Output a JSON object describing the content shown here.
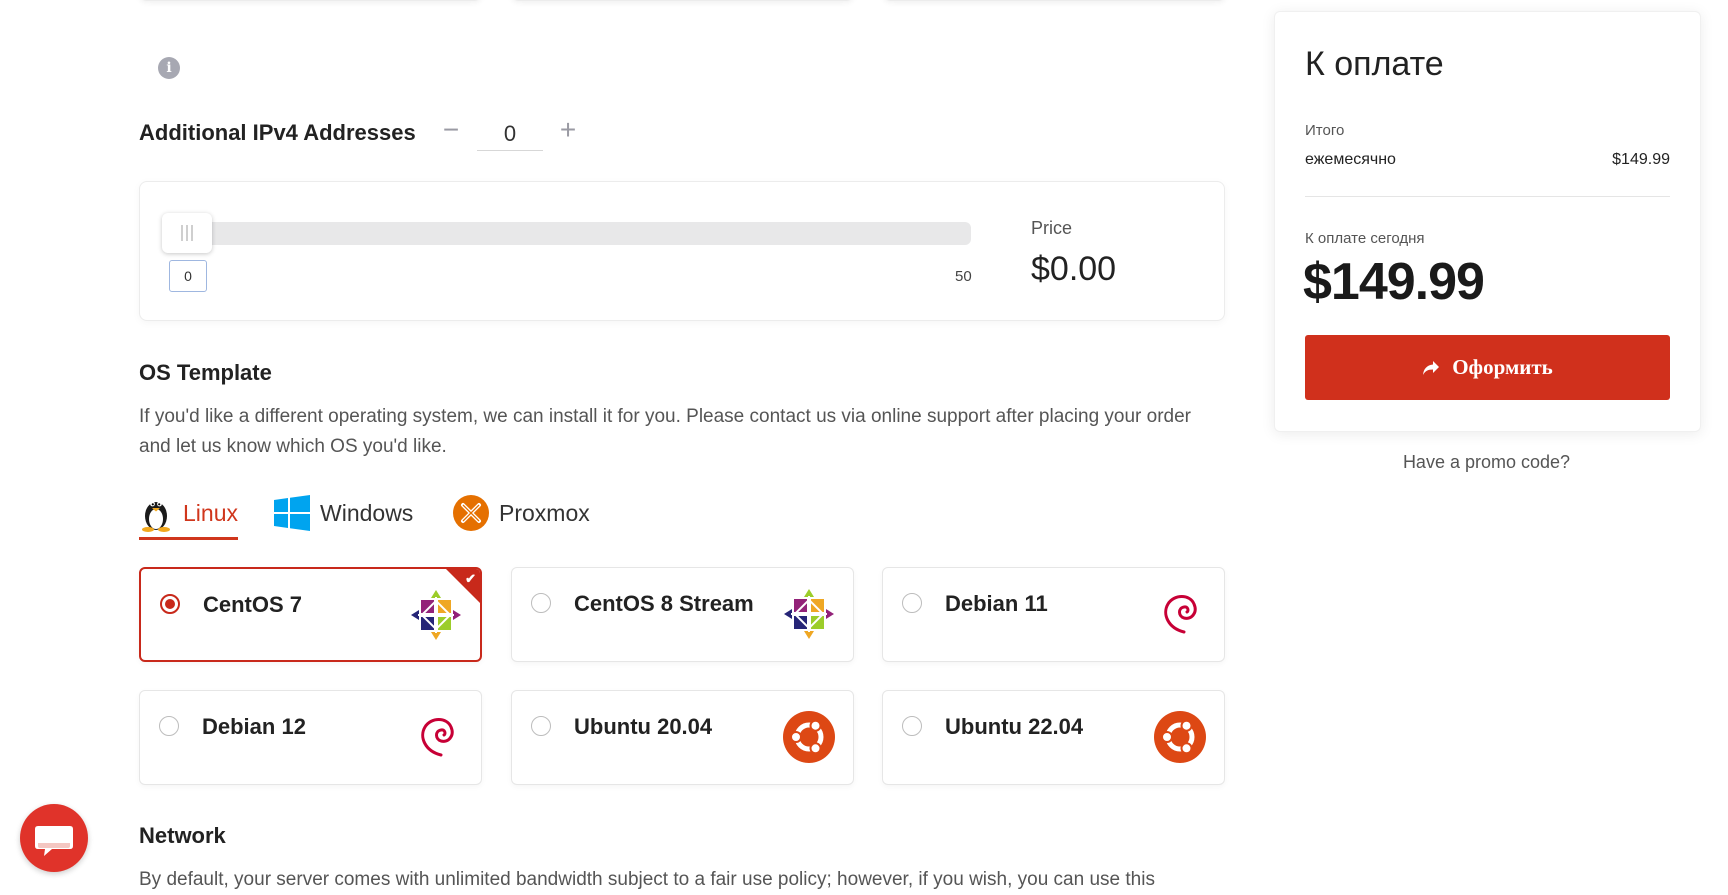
{
  "addons": {
    "ipv4_label": "Additional IPv4 Addresses",
    "ipv4_value": "0",
    "slider_min": "0",
    "slider_max": "50",
    "slider_fraction": 0,
    "price_label": "Price",
    "price_value": "$0.00"
  },
  "os": {
    "title": "OS Template",
    "description": "If you'd like a different operating system, we can install it for you. Please contact us via online support after placing your order and let us know which OS you'd like.",
    "tabs": [
      {
        "label": "Linux",
        "icon": "tux-icon",
        "active": true
      },
      {
        "label": "Windows",
        "icon": "windows-icon",
        "active": false
      },
      {
        "label": "Proxmox",
        "icon": "proxmox-icon",
        "active": false
      }
    ],
    "options": [
      {
        "name": "CentOS 7",
        "logo": "centos-logo-icon",
        "selected": true
      },
      {
        "name": "CentOS 8 Stream",
        "logo": "centos-logo-icon",
        "selected": false
      },
      {
        "name": "Debian 11",
        "logo": "debian-logo-icon",
        "selected": false
      },
      {
        "name": "Debian 12",
        "logo": "debian-logo-icon",
        "selected": false
      },
      {
        "name": "Ubuntu 20.04",
        "logo": "ubuntu-logo-icon",
        "selected": false
      },
      {
        "name": "Ubuntu 22.04",
        "logo": "ubuntu-logo-icon",
        "selected": false
      }
    ]
  },
  "network": {
    "title": "Network",
    "description": "By default, your server comes with unlimited bandwidth subject to a fair use policy; however, if you wish, you can use this"
  },
  "summary": {
    "title": "К оплате",
    "itogo_label": "Итого",
    "period_label": "ежемесячно",
    "period_price": "$149.99",
    "today_label": "К оплате сегодня",
    "today_total": "$149.99",
    "checkout_label": "Оформить",
    "promo_link": "Have a promo code?"
  },
  "colors": {
    "accent": "#d0301c",
    "selected_border": "#c8291b",
    "ubuntu": "#dd4814",
    "debian": "#c70036"
  }
}
